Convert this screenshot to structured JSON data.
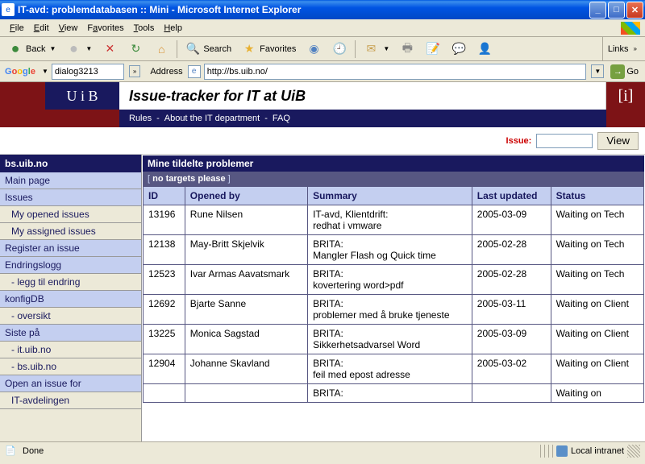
{
  "window": {
    "title": "IT-avd: problemdatabasen :: Mini - Microsoft Internet Explorer"
  },
  "menus": {
    "file": "File",
    "edit": "Edit",
    "view": "View",
    "favorites": "Favorites",
    "tools": "Tools",
    "help": "Help"
  },
  "toolbar": {
    "back": "Back",
    "search": "Search",
    "favorites": "Favorites",
    "links": "Links"
  },
  "address": {
    "google_label": "Google",
    "google_value": "dialog3213",
    "address_label": "Address",
    "url": "http://bs.uib.no/",
    "go": "Go"
  },
  "page": {
    "uib": "U i B",
    "title": "Issue-tracker for IT at UiB",
    "links": {
      "rules": "Rules",
      "about": "About the IT department",
      "faq": "FAQ"
    },
    "issue_label": "Issue:",
    "view_btn": "View"
  },
  "sidebar": {
    "header": "bs.uib.no",
    "items": [
      {
        "label": "Main page",
        "sub": false
      },
      {
        "label": "Issues",
        "sub": false
      },
      {
        "label": "My opened issues",
        "sub": true
      },
      {
        "label": "My assigned issues",
        "sub": true
      },
      {
        "label": "Register an issue",
        "sub": false
      },
      {
        "label": "Endringslogg",
        "sub": false
      },
      {
        "label": " - legg til endring",
        "sub": true
      },
      {
        "label": "konfigDB",
        "sub": false
      },
      {
        "label": " - oversikt",
        "sub": true
      },
      {
        "label": "Siste på",
        "sub": false
      },
      {
        "label": " - it.uib.no",
        "sub": true
      },
      {
        "label": " - bs.uib.no",
        "sub": true
      },
      {
        "label": "Open an issue for",
        "sub": false
      },
      {
        "label": "  IT-avdelingen",
        "sub": true
      }
    ]
  },
  "table": {
    "title": "Mine tildelte problemer",
    "subtitle": "no targets please",
    "headers": {
      "id": "ID",
      "opened_by": "Opened by",
      "summary": "Summary",
      "updated": "Last updated",
      "status": "Status"
    },
    "rows": [
      {
        "id": "13196",
        "by": "Rune Nilsen",
        "summary": "IT-avd, Klientdrift:\nredhat i vmware",
        "updated": "2005-03-09",
        "status": "Waiting on Tech"
      },
      {
        "id": "12138",
        "by": "May-Britt Skjelvik",
        "summary": "BRITA:\nMangler Flash og Quick time",
        "updated": "2005-02-28",
        "status": "Waiting on Tech"
      },
      {
        "id": "12523",
        "by": "Ivar Armas Aavatsmark",
        "summary": "BRITA:\nkovertering word>pdf",
        "updated": "2005-02-28",
        "status": "Waiting on Tech"
      },
      {
        "id": "12692",
        "by": "Bjarte Sanne",
        "summary": "BRITA:\nproblemer med å bruke tjeneste",
        "updated": "2005-03-11",
        "status": "Waiting on Client"
      },
      {
        "id": "13225",
        "by": "Monica Sagstad",
        "summary": "BRITA:\nSikkerhetsadvarsel Word",
        "updated": "2005-03-09",
        "status": "Waiting on Client"
      },
      {
        "id": "12904",
        "by": "Johanne Skavland",
        "summary": "BRITA:\nfeil med epost adresse",
        "updated": "2005-03-02",
        "status": "Waiting on Client"
      },
      {
        "id": "",
        "by": "",
        "summary": "BRITA:",
        "updated": "",
        "status": "Waiting on"
      }
    ]
  },
  "status": {
    "done": "Done",
    "zone": "Local intranet"
  }
}
